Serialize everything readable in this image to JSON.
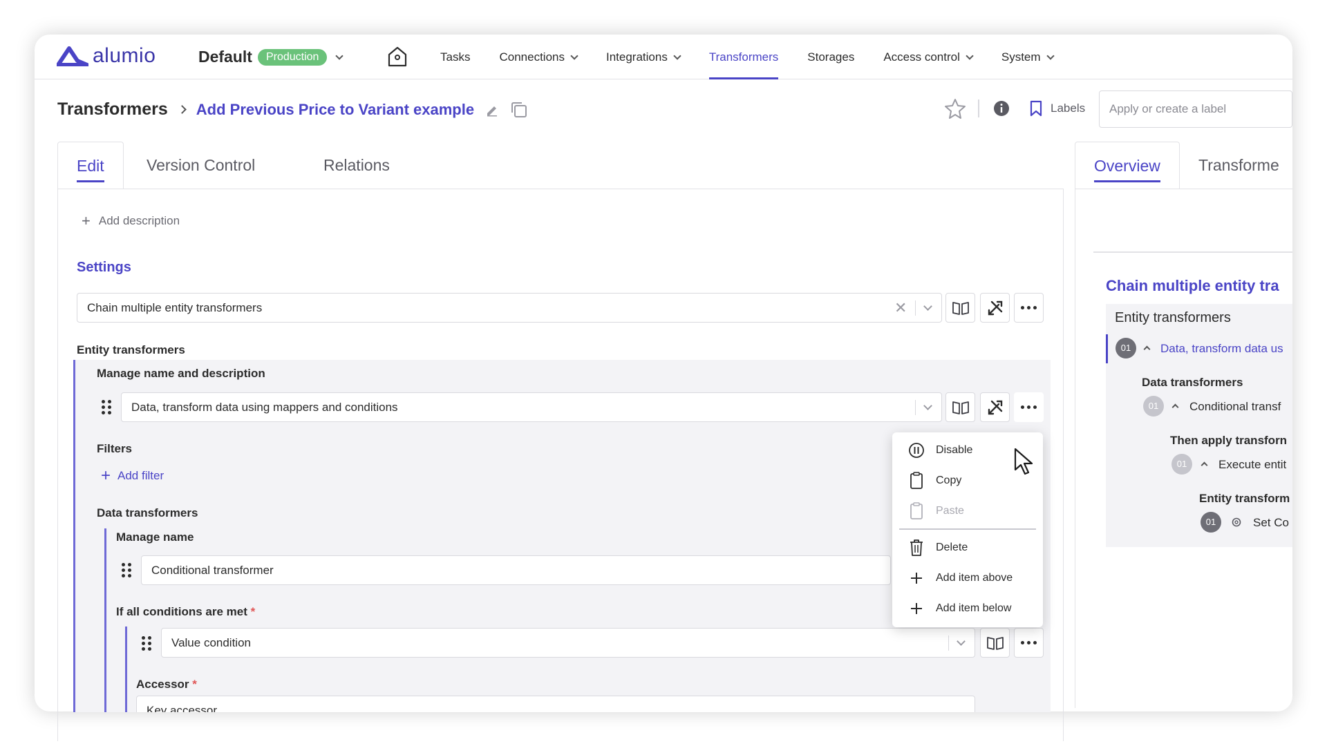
{
  "app": {
    "logo_text": "alumio"
  },
  "environment": {
    "name": "Default",
    "badge": "Production"
  },
  "nav": {
    "items": [
      {
        "label": "Tasks",
        "dropdown": false
      },
      {
        "label": "Connections",
        "dropdown": true
      },
      {
        "label": "Integrations",
        "dropdown": true
      },
      {
        "label": "Transformers",
        "dropdown": false,
        "active": true
      },
      {
        "label": "Storages",
        "dropdown": false
      },
      {
        "label": "Access control",
        "dropdown": true
      },
      {
        "label": "System",
        "dropdown": true
      }
    ]
  },
  "breadcrumb": {
    "root": "Transformers",
    "title": "Add Previous Price to Variant example"
  },
  "header": {
    "labels_label": "Labels",
    "label_placeholder": "Apply or create a label"
  },
  "tabs_left": [
    "Edit",
    "Version Control",
    "Relations"
  ],
  "tabs_right": [
    "Overview",
    "Transforme"
  ],
  "edit": {
    "add_description": "Add description",
    "settings_heading": "Settings",
    "main_select": "Chain multiple entity transformers",
    "entity_transformers_label": "Entity transformers",
    "manage_name_desc_label": "Manage name and description",
    "entity_select": "Data, transform data using mappers and conditions",
    "filters_label": "Filters",
    "add_filter": "Add filter",
    "data_transformers_label": "Data transformers",
    "manage_name_label": "Manage name",
    "conditional_select": "Conditional transformer",
    "conditions_label": "If all conditions are met",
    "value_condition_select": "Value condition",
    "accessor_label": "Accessor",
    "accessor_select": "Key accessor",
    "required_mark": "*"
  },
  "context_menu": {
    "items": [
      {
        "label": "Disable",
        "icon": "pause-circle-icon",
        "disabled": false
      },
      {
        "label": "Copy",
        "icon": "clipboard-icon",
        "disabled": false
      },
      {
        "label": "Paste",
        "icon": "clipboard-icon",
        "disabled": true
      },
      {
        "label": "Delete",
        "icon": "trash-icon",
        "disabled": false
      },
      {
        "label": "Add item above",
        "icon": "plus-icon",
        "disabled": false
      },
      {
        "label": "Add item below",
        "icon": "plus-icon",
        "disabled": false
      }
    ]
  },
  "overview": {
    "title": "Chain multiple entity tra",
    "entity_transformers": "Entity transformers",
    "step1_num": "01",
    "step1_label": "Data, transform data us",
    "data_transformers": "Data transformers",
    "step2_num": "01",
    "step2_label": "Conditional transf",
    "then_apply": "Then apply transforn",
    "step3_num": "01",
    "step3_label": "Execute entit",
    "entity_transform": "Entity transform",
    "step4_num": "01",
    "step4_label": "Set Co"
  },
  "colors": {
    "accent": "#4a44c6",
    "production": "#6ac27a",
    "group_bg": "#f3f3f6",
    "border": "#6e69d6"
  }
}
